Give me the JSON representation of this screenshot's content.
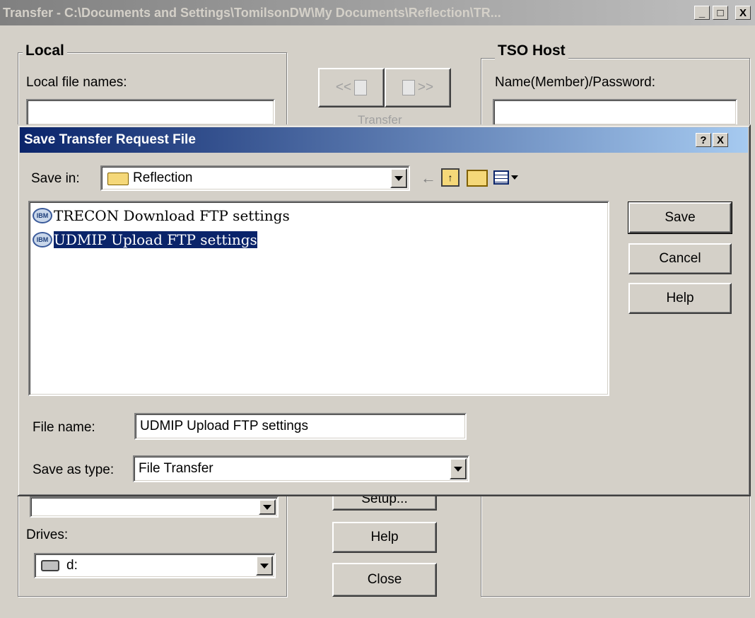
{
  "window": {
    "title": "Transfer - C:\\Documents and Settings\\TomilsonDW\\My Documents\\Reflection\\TR...",
    "buttons": {
      "minimize": "_",
      "maximize": "□",
      "close": "X"
    }
  },
  "local": {
    "group_title": "Local",
    "file_names_label": "Local file names:",
    "file_names_value": "",
    "drives_label": "Drives:",
    "drive_value": "d:"
  },
  "transfer": {
    "label": "Transfer",
    "download_glyph": "<<",
    "upload_glyph": ">>",
    "setup_label": "Setup...",
    "help_label": "Help",
    "close_label": "Close"
  },
  "host": {
    "group_title": "TSO Host",
    "name_label": "Name(Member)/Password:",
    "name_value": ""
  },
  "dialog": {
    "title": "Save Transfer Request File",
    "help_btn": "?",
    "close_btn": "X",
    "save_in_label": "Save in:",
    "save_in_value": "Reflection",
    "files": [
      {
        "icon": "IBM",
        "name": "TRECON Download FTP settings",
        "selected": false
      },
      {
        "icon": "IBM",
        "name": "UDMIP Upload FTP settings",
        "selected": true
      }
    ],
    "file_name_label": "File name:",
    "file_name_value": "UDMIP Upload FTP settings",
    "save_as_type_label": "Save as type:",
    "save_as_type_value": "File Transfer",
    "save_label": "Save",
    "cancel_label": "Cancel",
    "help_label": "Help"
  }
}
